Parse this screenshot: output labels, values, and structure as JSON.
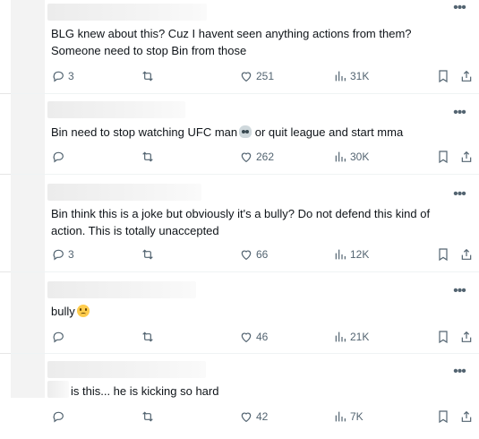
{
  "replies": [
    {
      "text": "BLG knew about this? Cuz I havent seen anything actions from them? Someone need to stop Bin from those",
      "reply_count": "3",
      "like_count": "251",
      "view_count": "31K"
    },
    {
      "text": "Bin need to stop watching UFC man",
      "text_after": " or quit league  and start mma",
      "reply_count": "",
      "like_count": "262",
      "view_count": "30K"
    },
    {
      "text": "Bin think this is a joke but obviously it's a bully? Do not defend this kind of action. This is totally unaccepted",
      "reply_count": "3",
      "like_count": "66",
      "view_count": "12K"
    },
    {
      "text": "bully",
      "reply_count": "",
      "like_count": "46",
      "view_count": "21K"
    },
    {
      "text": "is this... he is kicking so hard",
      "reply_count": "",
      "like_count": "42",
      "view_count": "7K"
    }
  ],
  "icons": {
    "more": "more-icon",
    "reply": "reply-icon",
    "repost": "repost-icon",
    "like": "heart-icon",
    "views": "views-icon",
    "bookmark": "bookmark-icon",
    "share": "share-icon"
  },
  "colors": {
    "icon": "#536471",
    "text": "#0f1419",
    "divider": "#eff3f4"
  }
}
